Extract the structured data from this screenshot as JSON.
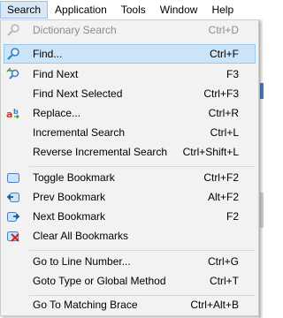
{
  "menubar": {
    "items": [
      "Search",
      "Application",
      "Tools",
      "Window",
      "Help"
    ]
  },
  "menu": {
    "items": [
      {
        "label": "Dictionary Search",
        "shortcut": "Ctrl+D",
        "icon": "dictionary-search-icon",
        "disabled": true
      },
      {
        "label": "Find...",
        "shortcut": "Ctrl+F",
        "icon": "find-icon",
        "highlighted": true
      },
      {
        "label": "Find Next",
        "shortcut": "F3",
        "icon": "find-next-icon"
      },
      {
        "label": "Find Next Selected",
        "shortcut": "Ctrl+F3"
      },
      {
        "label": "Replace...",
        "shortcut": "Ctrl+R",
        "icon": "replace-icon"
      },
      {
        "label": "Incremental Search",
        "shortcut": "Ctrl+L"
      },
      {
        "label": "Reverse Incremental Search",
        "shortcut": "Ctrl+Shift+L"
      },
      {
        "label": "Toggle Bookmark",
        "shortcut": "Ctrl+F2",
        "icon": "bookmark-icon"
      },
      {
        "label": "Prev Bookmark",
        "shortcut": "Alt+F2",
        "icon": "prev-bookmark-icon"
      },
      {
        "label": "Next Bookmark",
        "shortcut": "F2",
        "icon": "next-bookmark-icon"
      },
      {
        "label": "Clear All Bookmarks",
        "shortcut": "",
        "icon": "clear-bookmarks-icon"
      },
      {
        "label": "Go to Line Number...",
        "shortcut": "Ctrl+G"
      },
      {
        "label": "Goto Type or Global Method",
        "shortcut": "Ctrl+T"
      },
      {
        "label": "Go To Matching Brace",
        "shortcut": "Ctrl+Alt+B"
      }
    ]
  },
  "colors": {
    "highlight_bg": "#cce4f7",
    "highlight_border": "#99c9ef",
    "menu_bg": "#f2f2f2",
    "open_menu_bg": "#d9e8f7",
    "disabled_text": "#8c8c8c"
  }
}
